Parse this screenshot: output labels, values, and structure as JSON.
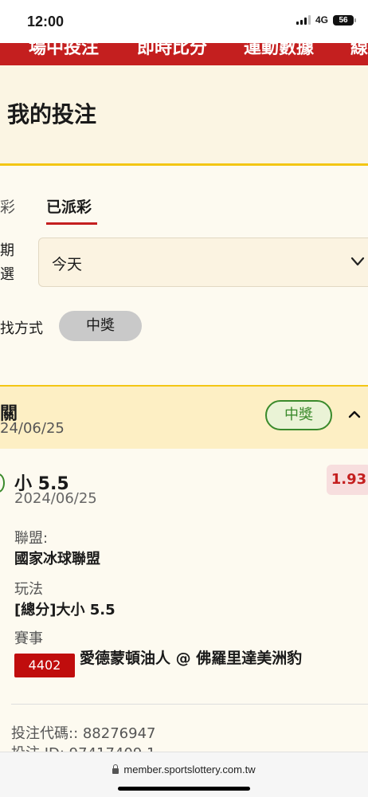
{
  "status_bar": {
    "time": "12:00",
    "network": "4G",
    "battery": "56"
  },
  "top_nav": {
    "items": [
      "場中投注",
      "即時比分",
      "運動數據",
      "線"
    ]
  },
  "page": {
    "title": "我的投注"
  },
  "tabs": {
    "previous_partial": "彩",
    "active": "已派彩"
  },
  "filters": {
    "date_label": "期選",
    "date_value": "今天",
    "method_label": "找方式",
    "method_value": "中獎"
  },
  "bet": {
    "type": "關",
    "date": "24/06/25",
    "status": "中獎",
    "selection": "小 5.5",
    "selection_date": "2024/06/25",
    "odds": "1.93",
    "league_label": "聯盟:",
    "league_value": "國家冰球聯盟",
    "play_label": "玩法",
    "play_value": "[總分]大小 5.5",
    "event_label": "賽事",
    "event_code": "4402",
    "event_name": "愛德蒙頓油人 @ 佛羅里達美洲豹",
    "bet_code": "投注代碼:: 88276947",
    "bet_id": "投注 ID: 97417409 1"
  },
  "browser": {
    "url": "member.sportslottery.com.tw"
  },
  "colors": {
    "brand_red": "#c41f1f",
    "accent_yellow": "#f3c614",
    "win_green": "#3a8a2b"
  }
}
